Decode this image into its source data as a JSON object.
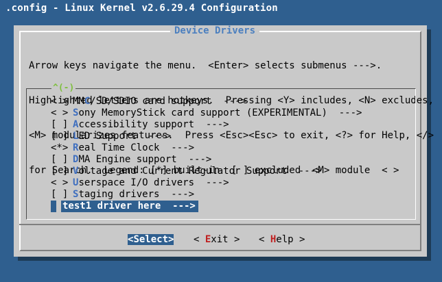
{
  "window": {
    "title": ".config - Linux Kernel v2.6.29.4 Configuration"
  },
  "dialog": {
    "title": "Device Drivers",
    "help_lines": [
      "Arrow keys navigate the menu.  <Enter> selects submenus --->.",
      "Highlighted letters are hotkeys.  Pressing <Y> includes, <N> excludes,",
      "<M> modularizes features.  Press <Esc><Esc> to exit, <?> for Help, </>",
      "for Search.  Legend: [*] built-in  [ ] excluded  <M> module  < >"
    ],
    "scroll_indicator": "^(-)"
  },
  "menu": {
    "items": [
      {
        "prefix": "< >",
        "hotkey": "",
        "pre": "MM",
        "hot": "C",
        "post": "/SD/SDIO card support  --->"
      },
      {
        "prefix": "< >",
        "pre": "",
        "hot": "S",
        "post": "ony MemoryStick card support (EXPERIMENTAL)  --->"
      },
      {
        "prefix": "[ ]",
        "pre": "",
        "hot": "A",
        "post": "ccessibility support  --->"
      },
      {
        "prefix": "[ ]",
        "pre": "",
        "hot": "L",
        "post": "ED Support  --->"
      },
      {
        "prefix": "<*>",
        "pre": "",
        "hot": "R",
        "post": "eal Time Clock  --->"
      },
      {
        "prefix": "[ ]",
        "pre": "",
        "hot": "D",
        "post": "MA Engine support  --->"
      },
      {
        "prefix": "[ ]",
        "pre": "",
        "hot": "V",
        "post": "oltage and Current Regulator Support  --->"
      },
      {
        "prefix": "< >",
        "pre": "",
        "hot": "U",
        "post": "serspace I/O drivers  --->"
      },
      {
        "prefix": "[ ]",
        "pre": "",
        "hot": "S",
        "post": "taging drivers  --->"
      },
      {
        "prefix": "",
        "pre": "",
        "hot": "",
        "post": "test1 driver here  --->",
        "selected": true
      }
    ]
  },
  "buttons": {
    "select": {
      "open": "<",
      "hot": "S",
      "rest": "elect",
      "close": ">"
    },
    "exit": {
      "open": "< ",
      "hot": "E",
      "rest": "xit",
      "close": " >"
    },
    "help": {
      "open": "< ",
      "hot": "H",
      "rest": "elp",
      "close": " >"
    }
  },
  "colors": {
    "background": "#2f5f8f",
    "dialog": "#c9c9c9",
    "title": "#4b7fbf",
    "hotkey_menu": "#3f6fbf",
    "hotkey_button": "#bf1f1f",
    "scroll_indicator": "#7fbf3f"
  }
}
